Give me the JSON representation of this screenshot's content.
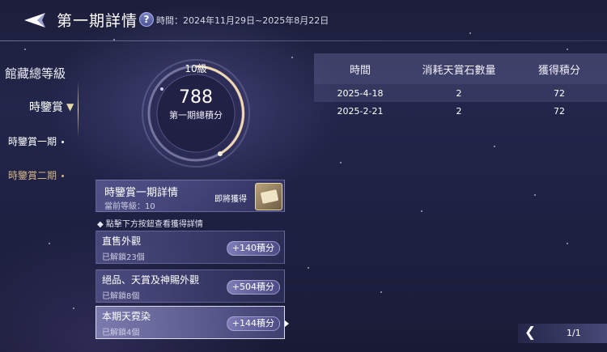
{
  "header": {
    "title": "第一期詳情",
    "help_icon": "question-icon",
    "period": "時間：2024年11月29日~2025年8月22日"
  },
  "sidebar": {
    "title": "館藏總等級",
    "section": "時鑒賞",
    "items": [
      {
        "label": "時鑒賞一期",
        "active": true
      },
      {
        "label": "時鑒賞二期",
        "active": false
      }
    ]
  },
  "dial": {
    "level": "10級",
    "points": "788",
    "points_label": "第一期總積分"
  },
  "detail": {
    "title": "時鑒賞一期詳情",
    "current_level": "當前等級：10",
    "upcoming_label": "即將獲得",
    "upcoming_icon": "scroll-item-icon"
  },
  "hint": "◆ 點擊下方按鈕查看獲得詳情",
  "rewards": [
    {
      "name": "直售外觀",
      "count": "已解鎖23個",
      "points": "+140積分"
    },
    {
      "name": "絕品、天賞及神賜外觀",
      "count": "已解鎖8個",
      "points": "+504積分"
    },
    {
      "name": "本期天霓染",
      "count": "已解鎖4個",
      "points": "+144積分"
    }
  ],
  "table": {
    "headers": [
      "時間",
      "消耗天賞石數量",
      "獲得積分"
    ],
    "rows": [
      [
        "2025-4-18",
        "2",
        "72"
      ],
      [
        "2025-2-21",
        "2",
        "72"
      ]
    ]
  },
  "pager": {
    "text": "1/1"
  },
  "colors": {
    "accent_gold": "#e8d9a8",
    "inactive_gold": "#d4b686",
    "background": "#1e2143"
  }
}
